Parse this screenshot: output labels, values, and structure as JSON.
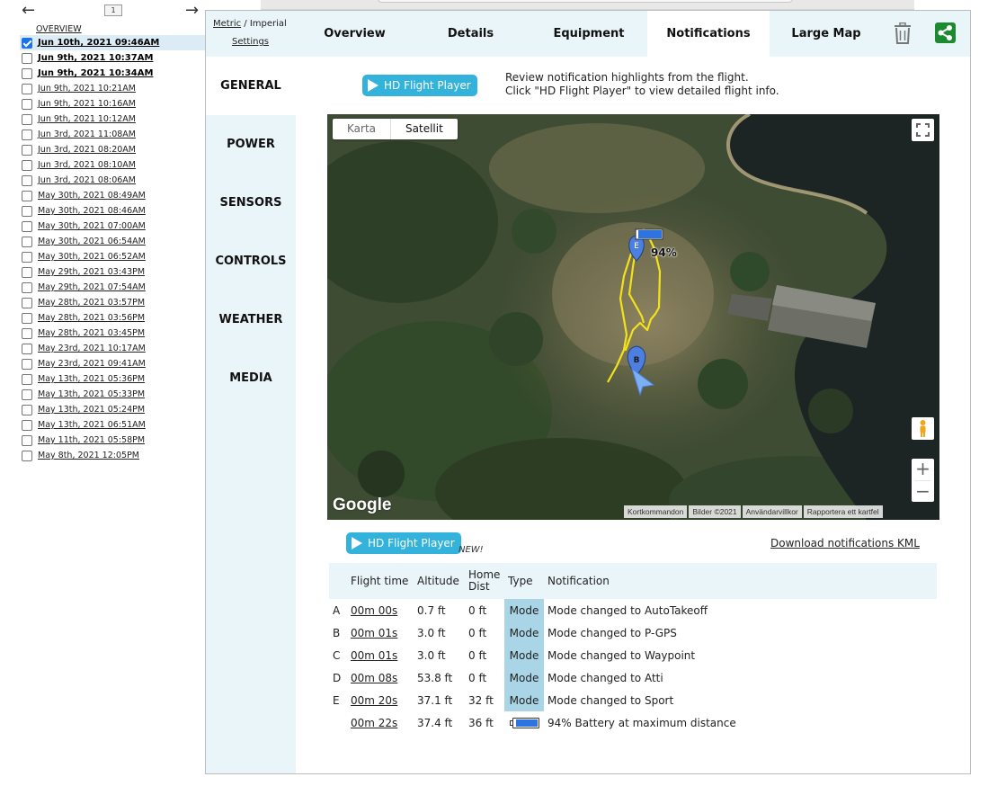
{
  "nav": {
    "prev_icon": "arrow-left-icon",
    "next_icon": "arrow-right-icon",
    "page": "1",
    "overview": "OVERVIEW"
  },
  "flights": [
    {
      "label": "Jun 10th, 2021 09:46AM",
      "checked": true,
      "bold": true
    },
    {
      "label": "Jun 9th, 2021 10:37AM",
      "checked": false,
      "bold": true
    },
    {
      "label": "Jun 9th, 2021 10:34AM",
      "checked": false,
      "bold": true
    },
    {
      "label": "Jun 9th, 2021 10:21AM",
      "checked": false,
      "bold": false
    },
    {
      "label": "Jun 9th, 2021 10:16AM",
      "checked": false,
      "bold": false
    },
    {
      "label": "Jun 9th, 2021 10:12AM",
      "checked": false,
      "bold": false
    },
    {
      "label": "Jun 3rd, 2021 11:08AM",
      "checked": false,
      "bold": false
    },
    {
      "label": "Jun 3rd, 2021 08:20AM",
      "checked": false,
      "bold": false
    },
    {
      "label": "Jun 3rd, 2021 08:10AM",
      "checked": false,
      "bold": false
    },
    {
      "label": "Jun 3rd, 2021 08:06AM",
      "checked": false,
      "bold": false
    },
    {
      "label": "May 30th, 2021 08:49AM",
      "checked": false,
      "bold": false
    },
    {
      "label": "May 30th, 2021 08:46AM",
      "checked": false,
      "bold": false
    },
    {
      "label": "May 30th, 2021 07:00AM",
      "checked": false,
      "bold": false
    },
    {
      "label": "May 30th, 2021 06:54AM",
      "checked": false,
      "bold": false
    },
    {
      "label": "May 30th, 2021 06:52AM",
      "checked": false,
      "bold": false
    },
    {
      "label": "May 29th, 2021 03:43PM",
      "checked": false,
      "bold": false
    },
    {
      "label": "May 29th, 2021 07:54AM",
      "checked": false,
      "bold": false
    },
    {
      "label": "May 28th, 2021 03:57PM",
      "checked": false,
      "bold": false
    },
    {
      "label": "May 28th, 2021 03:56PM",
      "checked": false,
      "bold": false
    },
    {
      "label": "May 28th, 2021 03:45PM",
      "checked": false,
      "bold": false
    },
    {
      "label": "May 23rd, 2021 10:17AM",
      "checked": false,
      "bold": false
    },
    {
      "label": "May 23rd, 2021 09:41AM",
      "checked": false,
      "bold": false
    },
    {
      "label": "May 13th, 2021 05:36PM",
      "checked": false,
      "bold": false
    },
    {
      "label": "May 13th, 2021 05:33PM",
      "checked": false,
      "bold": false
    },
    {
      "label": "May 13th, 2021 05:24PM",
      "checked": false,
      "bold": false
    },
    {
      "label": "May 13th, 2021 06:51AM",
      "checked": false,
      "bold": false
    },
    {
      "label": "May 11th, 2021 05:58PM",
      "checked": false,
      "bold": false
    },
    {
      "label": "May 8th, 2021 12:05PM",
      "checked": false,
      "bold": false
    }
  ],
  "units": {
    "metric": "Metric",
    "separator": " / ",
    "imperial": "Imperial",
    "settings": "Settings"
  },
  "tabs": [
    {
      "label": "Overview",
      "active": false
    },
    {
      "label": "Details",
      "active": false
    },
    {
      "label": "Equipment",
      "active": false
    },
    {
      "label": "Notifications",
      "active": true
    },
    {
      "label": "Large Map",
      "active": false
    }
  ],
  "toolbar": {
    "delete_icon": "trash-icon",
    "share_icon": "share-icon",
    "share_color": "#1c8a2e"
  },
  "side_nav": [
    "GENERAL",
    "POWER",
    "SENSORS",
    "CONTROLS",
    "WEATHER",
    "MEDIA"
  ],
  "player": {
    "button_label": "HD Flight Player",
    "review_line1": "Review notification highlights from the flight.",
    "review_line2": "Click \"HD Flight Player\" to view detailed flight info.",
    "new_label": "NEW!"
  },
  "map": {
    "type_options": [
      "Karta",
      "Satellit"
    ],
    "selected_type": "Satellit",
    "battery_label": "94%",
    "marker_start": "B",
    "marker_end": "E",
    "logo": "Google",
    "attribution": [
      "Kortkommandon",
      "Bilder ©2021",
      "Användarvillkor",
      "Rapportera ett kartfel"
    ],
    "zoom_in": "+",
    "zoom_out": "−",
    "track_color": "#f2e21a",
    "marker_color": "#4c7fe0"
  },
  "notifications": {
    "kml_link": "Download notifications KML",
    "headers": {
      "flight_time": "Flight time",
      "altitude": "Altitude",
      "home_dist": "Home Dist",
      "type": "Type",
      "notification": "Notification"
    },
    "rows": [
      {
        "id": "A",
        "time": "00m 00s",
        "alt": "0.7 ft",
        "dist": "0 ft",
        "type": "Mode",
        "text": "Mode changed to AutoTakeoff"
      },
      {
        "id": "B",
        "time": "00m 01s",
        "alt": "3.0 ft",
        "dist": "0 ft",
        "type": "Mode",
        "text": "Mode changed to P-GPS"
      },
      {
        "id": "C",
        "time": "00m 01s",
        "alt": "3.0 ft",
        "dist": "0 ft",
        "type": "Mode",
        "text": "Mode changed to Waypoint"
      },
      {
        "id": "D",
        "time": "00m 08s",
        "alt": "53.8 ft",
        "dist": "0 ft",
        "type": "Mode",
        "text": "Mode changed to Atti"
      },
      {
        "id": "E",
        "time": "00m 20s",
        "alt": "37.1 ft",
        "dist": "32 ft",
        "type": "Mode",
        "text": "Mode changed to Sport"
      },
      {
        "id": "",
        "time": "00m 22s",
        "alt": "37.4 ft",
        "dist": "36 ft",
        "type": "battery",
        "battery_level": 0.94,
        "text": "94% Battery at maximum distance"
      }
    ],
    "type_color": "#a9d5e6",
    "battery_color": "#2d74e0"
  }
}
